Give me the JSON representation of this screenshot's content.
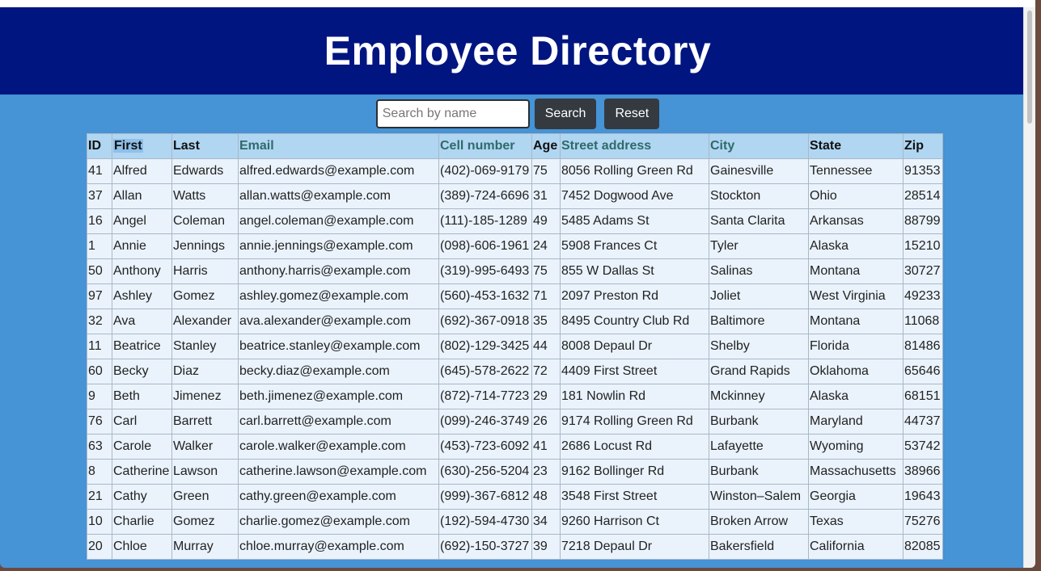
{
  "header": {
    "title": "Employee Directory"
  },
  "search": {
    "placeholder": "Search by name",
    "value": "",
    "search_label": "Search",
    "reset_label": "Reset"
  },
  "table": {
    "columns": [
      "ID",
      "First",
      "Last",
      "Email",
      "Cell number",
      "Age",
      "Street address",
      "City",
      "State",
      "Zip"
    ],
    "rows": [
      [
        "41",
        "Alfred",
        "Edwards",
        "alfred.edwards@example.com",
        "(402)-069-9179",
        "75",
        "8056 Rolling Green Rd",
        "Gainesville",
        "Tennessee",
        "91353"
      ],
      [
        "37",
        "Allan",
        "Watts",
        "allan.watts@example.com",
        "(389)-724-6696",
        "31",
        "7452 Dogwood Ave",
        "Stockton",
        "Ohio",
        "28514"
      ],
      [
        "16",
        "Angel",
        "Coleman",
        "angel.coleman@example.com",
        "(111)-185-1289",
        "49",
        "5485 Adams St",
        "Santa Clarita",
        "Arkansas",
        "88799"
      ],
      [
        "1",
        "Annie",
        "Jennings",
        "annie.jennings@example.com",
        "(098)-606-1961",
        "24",
        "5908 Frances Ct",
        "Tyler",
        "Alaska",
        "15210"
      ],
      [
        "50",
        "Anthony",
        "Harris",
        "anthony.harris@example.com",
        "(319)-995-6493",
        "75",
        "855 W Dallas St",
        "Salinas",
        "Montana",
        "30727"
      ],
      [
        "97",
        "Ashley",
        "Gomez",
        "ashley.gomez@example.com",
        "(560)-453-1632",
        "71",
        "2097 Preston Rd",
        "Joliet",
        "West Virginia",
        "49233"
      ],
      [
        "32",
        "Ava",
        "Alexander",
        "ava.alexander@example.com",
        "(692)-367-0918",
        "35",
        "8495 Country Club Rd",
        "Baltimore",
        "Montana",
        "11068"
      ],
      [
        "11",
        "Beatrice",
        "Stanley",
        "beatrice.stanley@example.com",
        "(802)-129-3425",
        "44",
        "8008 Depaul Dr",
        "Shelby",
        "Florida",
        "81486"
      ],
      [
        "60",
        "Becky",
        "Diaz",
        "becky.diaz@example.com",
        "(645)-578-2622",
        "72",
        "4409 First Street",
        "Grand Rapids",
        "Oklahoma",
        "65646"
      ],
      [
        "9",
        "Beth",
        "Jimenez",
        "beth.jimenez@example.com",
        "(872)-714-7723",
        "29",
        "181 Nowlin Rd",
        "Mckinney",
        "Alaska",
        "68151"
      ],
      [
        "76",
        "Carl",
        "Barrett",
        "carl.barrett@example.com",
        "(099)-246-3749",
        "26",
        "9174 Rolling Green Rd",
        "Burbank",
        "Maryland",
        "44737"
      ],
      [
        "63",
        "Carole",
        "Walker",
        "carole.walker@example.com",
        "(453)-723-6092",
        "41",
        "2686 Locust Rd",
        "Lafayette",
        "Wyoming",
        "53742"
      ],
      [
        "8",
        "Catherine",
        "Lawson",
        "catherine.lawson@example.com",
        "(630)-256-5204",
        "23",
        "9162 Bollinger Rd",
        "Burbank",
        "Massachusetts",
        "38966"
      ],
      [
        "21",
        "Cathy",
        "Green",
        "cathy.green@example.com",
        "(999)-367-6812",
        "48",
        "3548 First Street",
        "Winston–Salem",
        "Georgia",
        "19643"
      ],
      [
        "10",
        "Charlie",
        "Gomez",
        "charlie.gomez@example.com",
        "(192)-594-4730",
        "34",
        "9260 Harrison Ct",
        "Broken Arrow",
        "Texas",
        "75276"
      ],
      [
        "20",
        "Chloe",
        "Murray",
        "chloe.murray@example.com",
        "(692)-150-3727",
        "39",
        "7218 Depaul Dr",
        "Bakersfield",
        "California",
        "82085"
      ]
    ]
  }
}
